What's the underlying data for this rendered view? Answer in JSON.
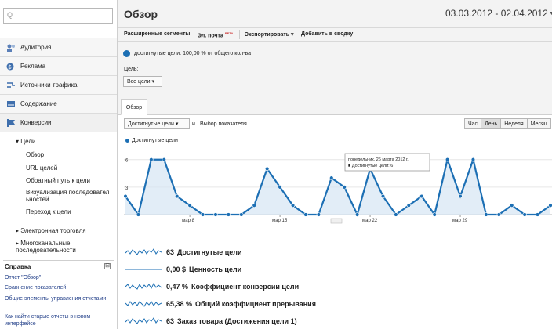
{
  "sidebar": {
    "search_icon": "Q",
    "items": [
      {
        "label": "Аудитория",
        "icon": "audience-icon"
      },
      {
        "label": "Реклама",
        "icon": "ads-icon"
      },
      {
        "label": "Источники трафика",
        "icon": "traffic-icon"
      },
      {
        "label": "Содержание",
        "icon": "content-icon"
      },
      {
        "label": "Конверсии",
        "icon": "conversions-icon"
      }
    ],
    "goals_heading": "▾ Цели",
    "goals_sub": [
      "Обзор",
      "URL целей",
      "Обратный путь к цели",
      "Визуализация последовател ьностей",
      "Переход к цели"
    ],
    "ecommerce": "▸ Электронная торговля",
    "multichannel": "▸ Многоканальные последовательности",
    "help": {
      "title": "Справка",
      "toggle": "⊟",
      "links": [
        "Отчет \"Обзор\"",
        "Сравнение показателей",
        "Общие элементы управления отчетами",
        "Как найти старые отчеты в новом интерфейсе"
      ]
    }
  },
  "header": {
    "title": "Обзор",
    "date_range": "03.03.2012 - 02.04.2012"
  },
  "toolbar": {
    "advanced_segments": "Расширенные сегменты",
    "email": "Эл. почта",
    "beta": "BETA",
    "export": "Экспортировать ▾",
    "add_to_dashboard": "Добавить в сводку"
  },
  "segment": {
    "text": "достигнутые цели: 100,00 % от общего кол-ва"
  },
  "goal": {
    "label": "Цель:",
    "select": "Все цели ▾"
  },
  "tab": {
    "label": "Обзор"
  },
  "chart_controls": {
    "metric": "Достигнутые цели ▾",
    "and": "и",
    "choose_metric": "Выбор показателя",
    "periods": [
      "Час",
      "День",
      "Неделя",
      "Месяц"
    ],
    "active_period": "День"
  },
  "chart_data": {
    "type": "line",
    "legend": "Достигнутые цели",
    "y_ticks": [
      "6",
      "3"
    ],
    "x_tick_labels": [
      "мар 8",
      "мар 15",
      "мар 22",
      "мар 29"
    ],
    "ylim": [
      0,
      7
    ],
    "values": [
      2,
      0,
      6,
      6,
      2,
      1,
      0,
      0,
      0,
      0,
      1,
      5,
      3,
      1,
      0,
      0,
      4,
      3,
      0,
      5,
      2,
      0,
      1,
      2,
      0,
      6,
      2,
      6,
      0,
      0,
      1,
      0,
      0,
      1
    ],
    "tooltip": {
      "line1": "понедельник, 26 марта 2012 г.",
      "line2": "■ Достигнутые цели: 6",
      "point_index": 27
    }
  },
  "summary": [
    {
      "value": "63",
      "label": "Достигнутые цели"
    },
    {
      "value": "0,00 $",
      "label": "Ценность цели"
    },
    {
      "value": "0,47 %",
      "label": "Коэффициент конверсии цели"
    },
    {
      "value": "65,38 %",
      "label": "Общий коэффициент прерывания"
    },
    {
      "value": "63",
      "label": "Заказ товара (Достижения цели 1)"
    }
  ],
  "colors": {
    "line": "#1c6fb4",
    "fill": "#d6e6f4"
  }
}
